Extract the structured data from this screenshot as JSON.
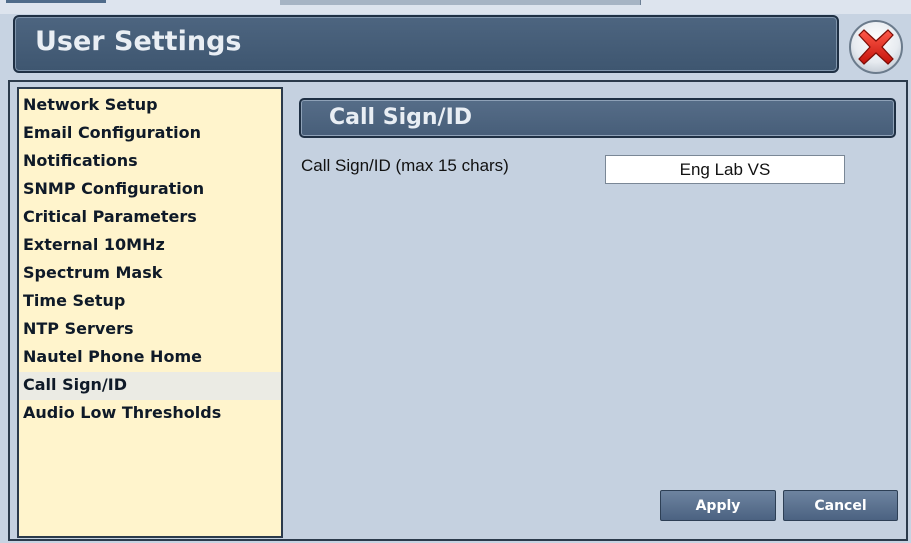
{
  "header": {
    "title": "User Settings",
    "close_icon": "close-x-icon",
    "accent_color": "#475e79"
  },
  "sidebar": {
    "items": [
      {
        "label": "Network Setup"
      },
      {
        "label": "Email Configuration"
      },
      {
        "label": "Notifications"
      },
      {
        "label": "SNMP Configuration"
      },
      {
        "label": "Critical Parameters"
      },
      {
        "label": "External 10MHz"
      },
      {
        "label": "Spectrum Mask"
      },
      {
        "label": "Time Setup"
      },
      {
        "label": "NTP Servers"
      },
      {
        "label": "Nautel Phone Home"
      },
      {
        "label": "Call Sign/ID"
      },
      {
        "label": "Audio Low Thresholds"
      }
    ],
    "selected": "Call Sign/ID",
    "background_color": "#fff4cc"
  },
  "content": {
    "section_title": "Call Sign/ID",
    "field_label": "Call Sign/ID (max 15 chars)",
    "field_value": "Eng Lab VS"
  },
  "buttons": {
    "apply_label": "Apply",
    "cancel_label": "Cancel"
  }
}
